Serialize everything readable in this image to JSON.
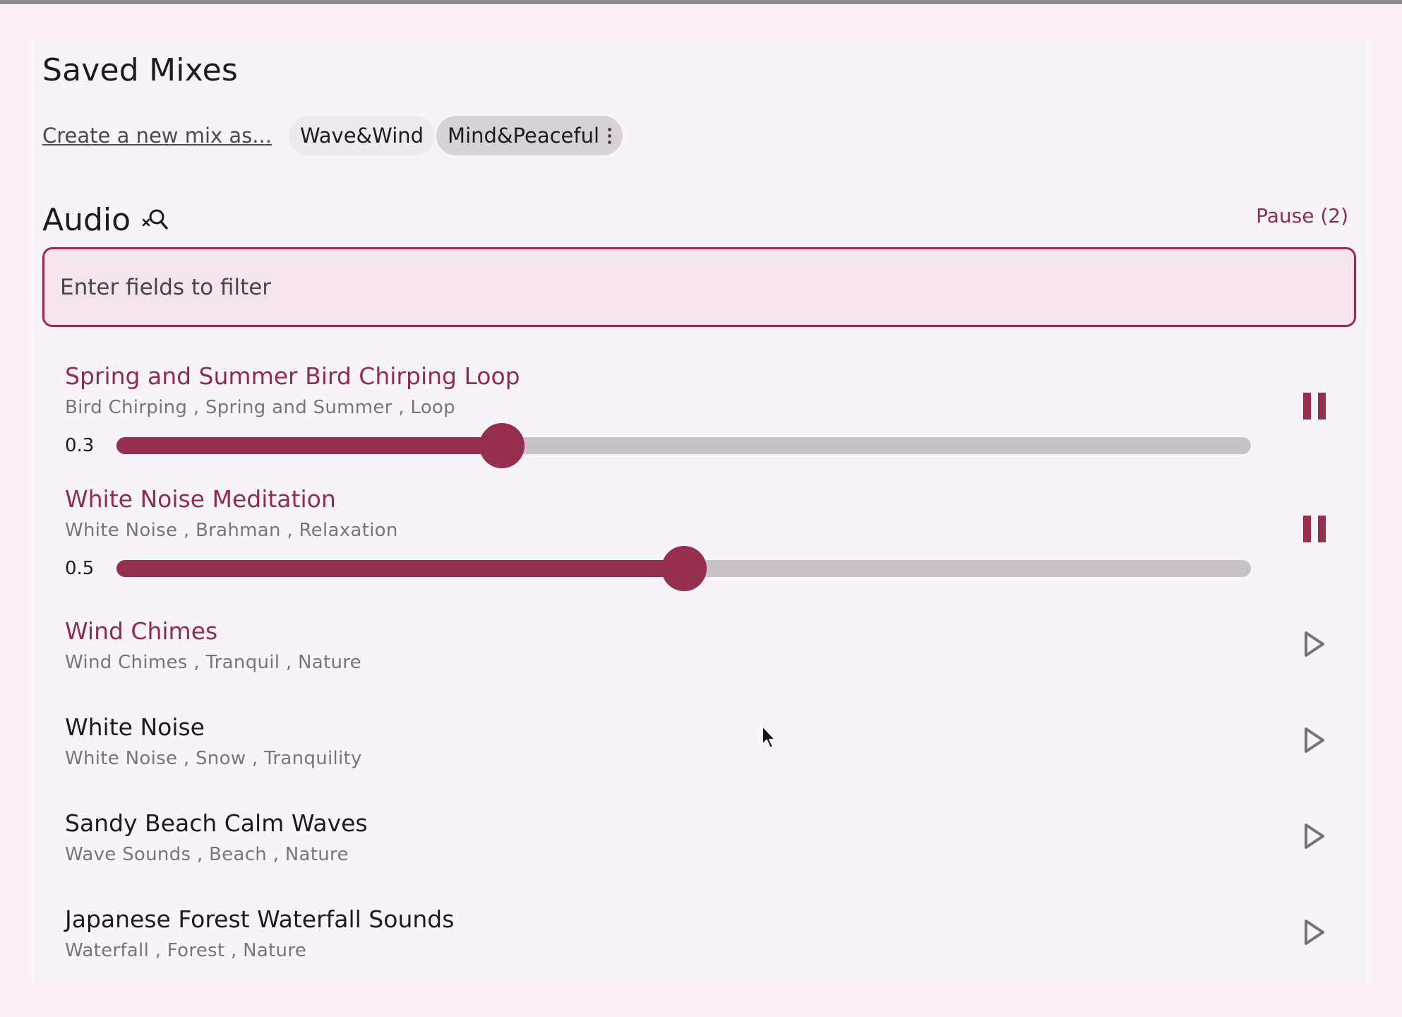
{
  "saved_mixes": {
    "title": "Saved Mixes",
    "create_link": "Create a new mix as...",
    "mixes": [
      {
        "label": "Wave&Wind",
        "selected": false
      },
      {
        "label": "Mind&Peaceful",
        "selected": true
      }
    ]
  },
  "audio": {
    "title": "Audio",
    "pause_all_label": "Pause (2)",
    "filter_placeholder": "Enter fields to filter",
    "tracks": [
      {
        "title": "Spring and Summer Bird Chirping Loop",
        "tags": "Bird Chirping , Spring and Summer , Loop",
        "playing": true,
        "volume_label": "0.3",
        "volume_fraction": 0.34
      },
      {
        "title": "White Noise Meditation",
        "tags": "White Noise , Brahman , Relaxation",
        "playing": true,
        "volume_label": "0.5",
        "volume_fraction": 0.5
      },
      {
        "title": "Wind Chimes",
        "tags": "Wind Chimes , Tranquil , Nature",
        "playing": false,
        "highlighted": true
      },
      {
        "title": "White Noise",
        "tags": "White Noise , Snow , Tranquility",
        "playing": false
      },
      {
        "title": "Sandy Beach Calm Waves",
        "tags": "Wave Sounds , Beach , Nature",
        "playing": false
      },
      {
        "title": "Japanese Forest Waterfall Sounds",
        "tags": "Waterfall , Forest , Nature",
        "playing": false
      }
    ]
  },
  "colors": {
    "accent": "#962f4d",
    "background": "#fbeef4",
    "surface": "#f8f3f8"
  },
  "icons": {
    "search_off": "search-off-icon",
    "pause": "pause-icon",
    "play": "play-icon",
    "more": "more-vert-icon"
  }
}
